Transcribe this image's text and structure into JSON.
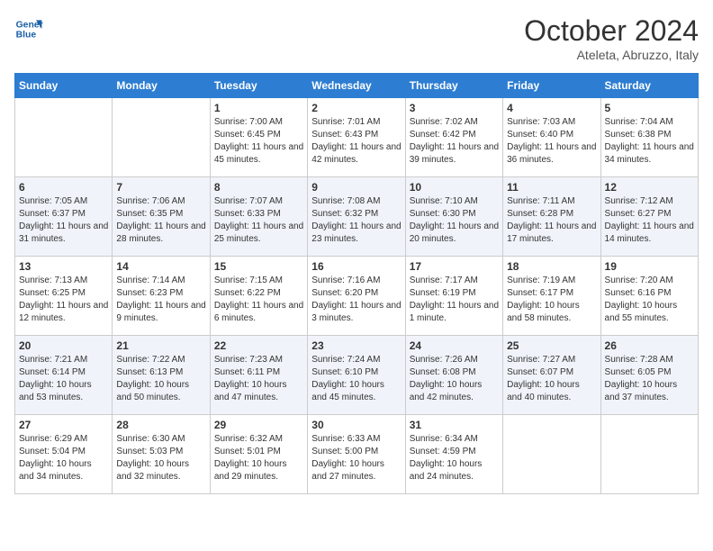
{
  "header": {
    "logo_line1": "General",
    "logo_line2": "Blue",
    "month": "October 2024",
    "location": "Ateleta, Abruzzo, Italy"
  },
  "weekdays": [
    "Sunday",
    "Monday",
    "Tuesday",
    "Wednesday",
    "Thursday",
    "Friday",
    "Saturday"
  ],
  "weeks": [
    [
      null,
      null,
      {
        "day": 1,
        "sunrise": "7:00 AM",
        "sunset": "6:45 PM",
        "daylight": "11 hours and 45 minutes."
      },
      {
        "day": 2,
        "sunrise": "7:01 AM",
        "sunset": "6:43 PM",
        "daylight": "11 hours and 42 minutes."
      },
      {
        "day": 3,
        "sunrise": "7:02 AM",
        "sunset": "6:42 PM",
        "daylight": "11 hours and 39 minutes."
      },
      {
        "day": 4,
        "sunrise": "7:03 AM",
        "sunset": "6:40 PM",
        "daylight": "11 hours and 36 minutes."
      },
      {
        "day": 5,
        "sunrise": "7:04 AM",
        "sunset": "6:38 PM",
        "daylight": "11 hours and 34 minutes."
      }
    ],
    [
      {
        "day": 6,
        "sunrise": "7:05 AM",
        "sunset": "6:37 PM",
        "daylight": "11 hours and 31 minutes."
      },
      {
        "day": 7,
        "sunrise": "7:06 AM",
        "sunset": "6:35 PM",
        "daylight": "11 hours and 28 minutes."
      },
      {
        "day": 8,
        "sunrise": "7:07 AM",
        "sunset": "6:33 PM",
        "daylight": "11 hours and 25 minutes."
      },
      {
        "day": 9,
        "sunrise": "7:08 AM",
        "sunset": "6:32 PM",
        "daylight": "11 hours and 23 minutes."
      },
      {
        "day": 10,
        "sunrise": "7:10 AM",
        "sunset": "6:30 PM",
        "daylight": "11 hours and 20 minutes."
      },
      {
        "day": 11,
        "sunrise": "7:11 AM",
        "sunset": "6:28 PM",
        "daylight": "11 hours and 17 minutes."
      },
      {
        "day": 12,
        "sunrise": "7:12 AM",
        "sunset": "6:27 PM",
        "daylight": "11 hours and 14 minutes."
      }
    ],
    [
      {
        "day": 13,
        "sunrise": "7:13 AM",
        "sunset": "6:25 PM",
        "daylight": "11 hours and 12 minutes."
      },
      {
        "day": 14,
        "sunrise": "7:14 AM",
        "sunset": "6:23 PM",
        "daylight": "11 hours and 9 minutes."
      },
      {
        "day": 15,
        "sunrise": "7:15 AM",
        "sunset": "6:22 PM",
        "daylight": "11 hours and 6 minutes."
      },
      {
        "day": 16,
        "sunrise": "7:16 AM",
        "sunset": "6:20 PM",
        "daylight": "11 hours and 3 minutes."
      },
      {
        "day": 17,
        "sunrise": "7:17 AM",
        "sunset": "6:19 PM",
        "daylight": "11 hours and 1 minute."
      },
      {
        "day": 18,
        "sunrise": "7:19 AM",
        "sunset": "6:17 PM",
        "daylight": "10 hours and 58 minutes."
      },
      {
        "day": 19,
        "sunrise": "7:20 AM",
        "sunset": "6:16 PM",
        "daylight": "10 hours and 55 minutes."
      }
    ],
    [
      {
        "day": 20,
        "sunrise": "7:21 AM",
        "sunset": "6:14 PM",
        "daylight": "10 hours and 53 minutes."
      },
      {
        "day": 21,
        "sunrise": "7:22 AM",
        "sunset": "6:13 PM",
        "daylight": "10 hours and 50 minutes."
      },
      {
        "day": 22,
        "sunrise": "7:23 AM",
        "sunset": "6:11 PM",
        "daylight": "10 hours and 47 minutes."
      },
      {
        "day": 23,
        "sunrise": "7:24 AM",
        "sunset": "6:10 PM",
        "daylight": "10 hours and 45 minutes."
      },
      {
        "day": 24,
        "sunrise": "7:26 AM",
        "sunset": "6:08 PM",
        "daylight": "10 hours and 42 minutes."
      },
      {
        "day": 25,
        "sunrise": "7:27 AM",
        "sunset": "6:07 PM",
        "daylight": "10 hours and 40 minutes."
      },
      {
        "day": 26,
        "sunrise": "7:28 AM",
        "sunset": "6:05 PM",
        "daylight": "10 hours and 37 minutes."
      }
    ],
    [
      {
        "day": 27,
        "sunrise": "6:29 AM",
        "sunset": "5:04 PM",
        "daylight": "10 hours and 34 minutes."
      },
      {
        "day": 28,
        "sunrise": "6:30 AM",
        "sunset": "5:03 PM",
        "daylight": "10 hours and 32 minutes."
      },
      {
        "day": 29,
        "sunrise": "6:32 AM",
        "sunset": "5:01 PM",
        "daylight": "10 hours and 29 minutes."
      },
      {
        "day": 30,
        "sunrise": "6:33 AM",
        "sunset": "5:00 PM",
        "daylight": "10 hours and 27 minutes."
      },
      {
        "day": 31,
        "sunrise": "6:34 AM",
        "sunset": "4:59 PM",
        "daylight": "10 hours and 24 minutes."
      },
      null,
      null
    ]
  ]
}
